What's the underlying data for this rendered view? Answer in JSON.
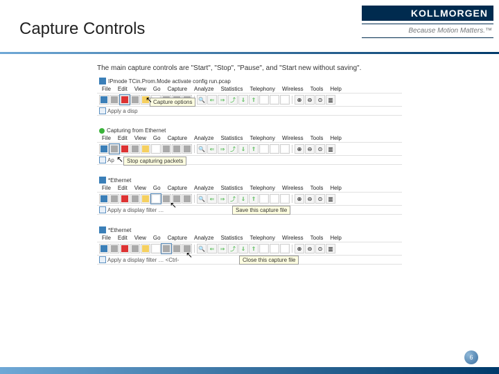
{
  "header": {
    "title": "Capture Controls",
    "brand": "KOLLMORGEN",
    "tagline": "Because Motion Matters.™"
  },
  "intro": "The main capture controls are \"Start\", \"Stop\", \"Pause\", and \"Start new without saving\".",
  "menu": [
    "File",
    "Edit",
    "View",
    "Go",
    "Capture",
    "Analyze",
    "Statistics",
    "Telephony",
    "Wireless",
    "Tools",
    "Help"
  ],
  "shots": [
    {
      "title": "IPmode TCin.Prom.Mode activate config run.pcap",
      "tooltip": "Capture options",
      "filter": "Apply a disp",
      "hl": 2,
      "green": false
    },
    {
      "title": "Capturing from Ethernet",
      "tooltip": "Stop capturing packets",
      "filter": "Ap",
      "hl": 1,
      "green": true
    },
    {
      "title": "*Ethernet",
      "tooltip": "Save this capture file",
      "filter": "Apply a display filter …",
      "hl": 5,
      "green": false
    },
    {
      "title": "*Ethernet",
      "tooltip": "Close this capture file",
      "filter": "Apply a display filter …  <Ctrl-",
      "hl": 6,
      "green": false
    }
  ],
  "tooltips": [
    "Capture options",
    "Stop capturing packets",
    "Save this capture file",
    "Close this capture file"
  ],
  "zoom_icons": [
    "⊕",
    "⊖",
    "⊙",
    "⎡⎦"
  ],
  "page": "6"
}
